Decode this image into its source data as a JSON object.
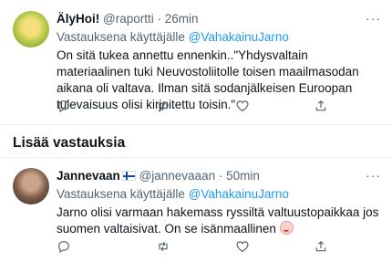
{
  "tweet1": {
    "name": "ÄlyHoi!",
    "handle": "@raportti",
    "sep": "·",
    "time": "26min",
    "replying_prefix": "Vastauksena käyttäjälle",
    "replying_to": "@VahakainuJarno",
    "text": "On sitä tukea annettu ennenkin..\"Yhdysvaltain materiaalinen tuki Neuvostoliitolle toisen maailmasodan aikana oli valtava. Ilman sitä sodanjälkeisen Euroopan tulevaisuus olisi kirjoitettu toisin.\""
  },
  "section_title": "Lisää vastauksia",
  "tweet2": {
    "name": "Jannevaan",
    "handle": "@jannevaaan",
    "sep": "·",
    "time": "50min",
    "replying_prefix": "Vastauksena käyttäjälle",
    "replying_to": "@VahakainuJarno",
    "text": "Jarno olisi varmaan hakemass ryssiltä valtuustopaikkaa jos suomen valtaisivat. On se isänmaallinen"
  },
  "icons": {
    "reply": "reply-icon",
    "retweet": "retweet-icon",
    "like": "heart-icon",
    "share": "share-icon",
    "more": "more-icon",
    "flag": "finland-flag-icon",
    "emoji": "clown-face-emoji"
  },
  "colors": {
    "link": "#1d9bf0",
    "muted": "#536471",
    "text": "#0f1419"
  }
}
